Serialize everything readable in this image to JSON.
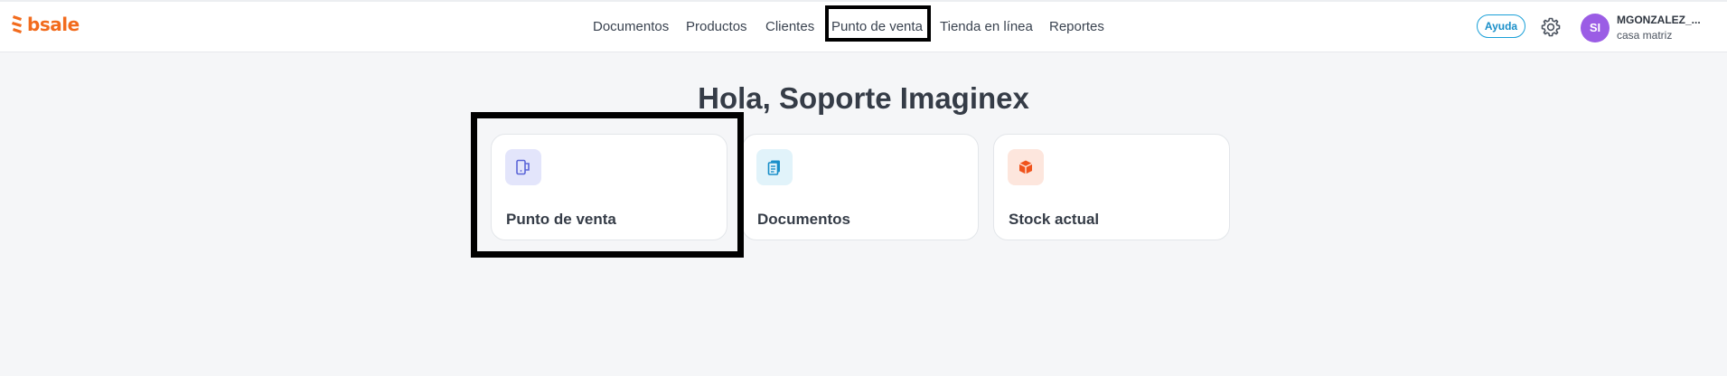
{
  "brand": {
    "name": "bsale",
    "color": "#f26b1d"
  },
  "nav": {
    "items": [
      {
        "label": "Documentos"
      },
      {
        "label": "Productos"
      },
      {
        "label": "Clientes"
      },
      {
        "label": "Punto de venta"
      },
      {
        "label": "Tienda en línea"
      },
      {
        "label": "Reportes"
      }
    ]
  },
  "header": {
    "help_label": "Ayuda",
    "settings_icon": "gear-icon",
    "avatar_initials": "SI",
    "avatar_color": "#9b5de5",
    "user_name": "MGONZALEZ_...",
    "branch": "casa matriz"
  },
  "main": {
    "greeting": "Hola, Soporte Imaginex",
    "cards": [
      {
        "label": "Punto de venta",
        "icon": "pos-terminal-icon",
        "icon_bg": "#e3e5fb",
        "icon_color": "#5a64d8"
      },
      {
        "label": "Documentos",
        "icon": "document-icon",
        "icon_bg": "#e1f3fa",
        "icon_color": "#1a8fc9"
      },
      {
        "label": "Stock actual",
        "icon": "box-icon",
        "icon_bg": "#fde6dd",
        "icon_color": "#f0531c"
      }
    ]
  }
}
